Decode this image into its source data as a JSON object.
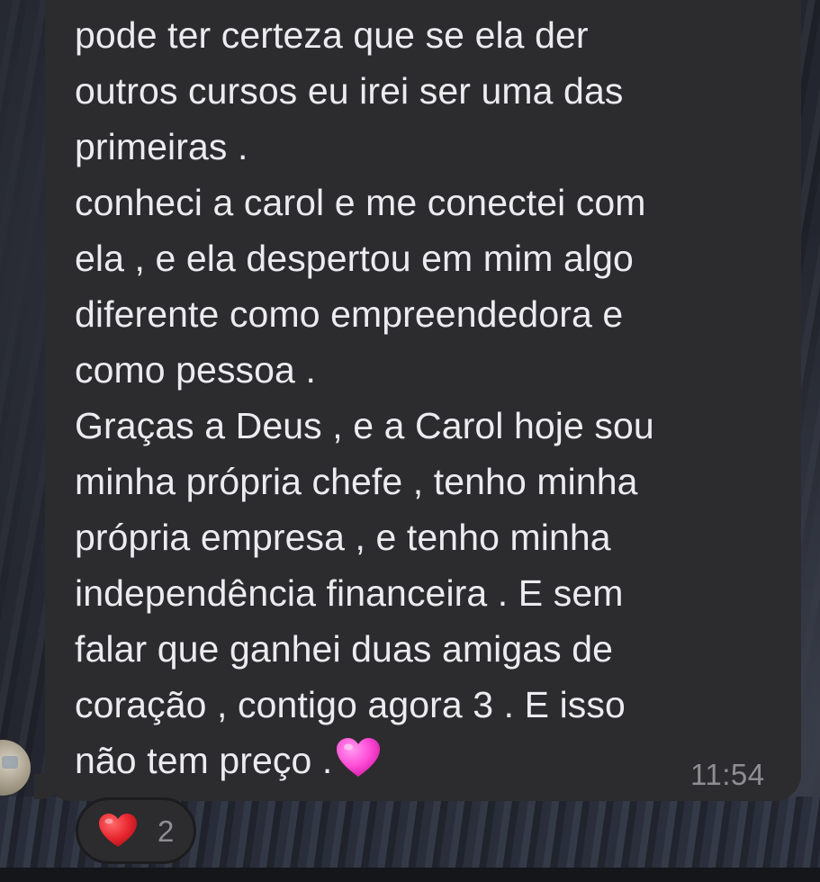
{
  "message": {
    "lines": [
      "pode ter certeza que se ela der",
      "outros cursos eu irei ser uma das",
      "primeiras .",
      "conheci a carol e me conectei com",
      "ela , e ela despertou em mim algo",
      "diferente como empreendedora e",
      "como pessoa .",
      "Graças a Deus , e a Carol hoje sou",
      "minha própria chefe , tenho minha",
      "própria empresa , e tenho minha",
      "independência financeira . E sem",
      "falar que ganhei duas amigas de",
      "coração , contigo agora 3 . E isso",
      "não tem preço ."
    ],
    "trailing_emoji": "pink-heart-icon",
    "timestamp": "11:54"
  },
  "reaction": {
    "icon": "red-heart-icon",
    "count": "2"
  },
  "colors": {
    "bubble": "#2c2c2e",
    "text": "#ececf0",
    "timestamp": "#8e8e93",
    "pink_heart": "#ff4fd8",
    "red_heart": "#e8262f"
  }
}
